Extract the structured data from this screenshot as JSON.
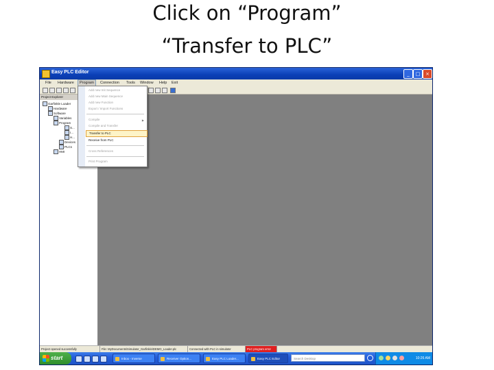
{
  "slide": {
    "title_line1": "Click on “Program”",
    "title_line2": "“Transfer to PLC”"
  },
  "window": {
    "title": "Easy PLC Editor",
    "buttons": {
      "minimize": "_",
      "maximize": "□",
      "close": "×"
    }
  },
  "menubar": {
    "items": [
      "File",
      "Hardware",
      "Program",
      "Connection",
      "Tools",
      "Window",
      "Help",
      "Exit"
    ],
    "active": "Program"
  },
  "project_pane": {
    "title": "Project Explorer",
    "tree": [
      "Garfinkle Loader",
      "Hardware",
      "Software",
      "Variables",
      "Program",
      "S...",
      "I...",
      "H...",
      "Devices",
      "PLCs",
      "HMI"
    ]
  },
  "program_menu": {
    "items": [
      {
        "label": "Add new Init Sequence",
        "enabled": false
      },
      {
        "label": "Add new Main Sequence",
        "enabled": false
      },
      {
        "label": "Add new Function",
        "enabled": false
      },
      {
        "label": "Export / Import Functions",
        "enabled": false
      },
      {
        "label": "Compile",
        "enabled": false,
        "submenu": true
      },
      {
        "label": "Compile and Transfer",
        "enabled": false
      },
      {
        "label": "Transfer to PLC",
        "enabled": true,
        "highlighted": true
      },
      {
        "label": "Receive from PLC",
        "enabled": true
      },
      {
        "label": "Cross References",
        "enabled": false
      },
      {
        "label": "Print Program",
        "enabled": false
      }
    ]
  },
  "statusbar": {
    "cells": [
      "Project opened successfully",
      "File: MyDocuments\\Simulator_Garfinkle\\DEMO_Loader.plc",
      "Connected with PLC in simulator",
      "PLC program error"
    ]
  },
  "taskbar": {
    "start_label": "start",
    "tasks": [
      {
        "label": "Inbox - Inverse",
        "active": false
      },
      {
        "label": "Receiver Option...",
        "active": false
      },
      {
        "label": "Easy PLC Loader...",
        "active": false
      },
      {
        "label": "Easy PLC Editor",
        "active": true
      }
    ],
    "search_placeholder": "Search Desktop",
    "clock": "10:26 AM"
  },
  "colors": {
    "titlebar": "#0b3fb6",
    "workspace": "#808080",
    "menu_highlight": "#fdf4c8",
    "taskbar": "#245edc",
    "start": "#2f8e2b"
  }
}
